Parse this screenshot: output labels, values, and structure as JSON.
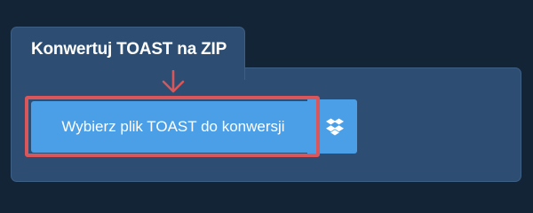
{
  "converter": {
    "tab_title": "Konwertuj TOAST na ZIP",
    "choose_file_label": "Wybierz plik TOAST do konwersji",
    "dropbox_icon": "dropbox-icon"
  },
  "colors": {
    "page_background": "#132436",
    "panel_background": "#2d4e72",
    "button_blue": "#4a9fe6",
    "highlight_red": "#d9575a"
  }
}
